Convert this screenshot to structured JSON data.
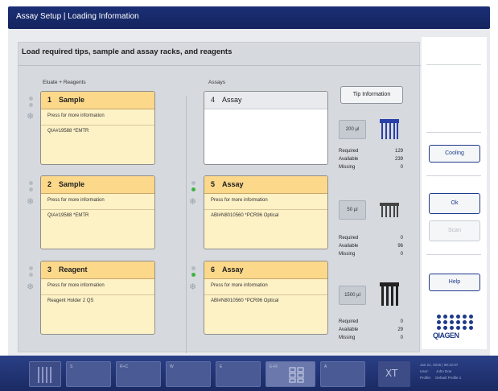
{
  "window": {
    "title": "Assay Setup | Loading Information"
  },
  "main": {
    "heading": "Load required tips, sample and assay racks, and reagents",
    "col_eluate": "Eluate + Reagents",
    "col_assays": "Assays",
    "tip_info_label": "Tip Information"
  },
  "left_cards": [
    {
      "num": "1",
      "title": "Sample",
      "info": "Press for more information",
      "sub": "QIA#19588 *EMTR"
    },
    {
      "num": "2",
      "title": "Sample",
      "info": "Press for more information",
      "sub": "QIA#19588 *EMTR"
    },
    {
      "num": "3",
      "title": "Reagent",
      "info": "Press for more information",
      "sub": "Reagent Holder 2 QS"
    }
  ],
  "assay_cards": [
    {
      "num": "4",
      "title": "Assay"
    },
    {
      "num": "5",
      "title": "Assay",
      "info": "Press for more information",
      "sub": "ABI#N8010560 *PCR96 Optical"
    },
    {
      "num": "6",
      "title": "Assay",
      "info": "Press for more information",
      "sub": "ABI#N8010560 *PCR96 Optical"
    }
  ],
  "tips": [
    {
      "volume": "200 µl",
      "required_label": "Required",
      "required": "129",
      "available_label": "Available",
      "available": "239",
      "missing_label": "Missing",
      "missing": "0",
      "color": "#2a3fa8"
    },
    {
      "volume": "50 µl",
      "required_label": "Required",
      "required": "0",
      "available_label": "Available",
      "available": "96",
      "missing_label": "Missing",
      "missing": "0",
      "color": "#444444"
    },
    {
      "volume": "1500 µl",
      "required_label": "Required",
      "required": "0",
      "available_label": "Available",
      "available": "29",
      "missing_label": "Missing",
      "missing": "0",
      "color": "#222222"
    }
  ],
  "sidebar": {
    "cooling": "Cooling",
    "ok": "Ok",
    "scan": "Scan",
    "help": "Help",
    "logo": "QIAGEN"
  },
  "taskbar": {
    "tiles": [
      {
        "label": "S"
      },
      {
        "label": "R+C"
      },
      {
        "label": "W"
      },
      {
        "label": "E"
      },
      {
        "label": "E+R"
      },
      {
        "label": "A"
      }
    ],
    "xt": "XT",
    "status_date": "Jan 21, 2015 | 08:12:07",
    "user_label": "User:",
    "user_value": "John Doe",
    "profile_label": "Profile:",
    "profile_value": "Default Profile 1"
  },
  "colors": {
    "brand": "#1b2f75",
    "card_yellow": "#fbd88a",
    "indicator_green": "#3fb33f"
  }
}
